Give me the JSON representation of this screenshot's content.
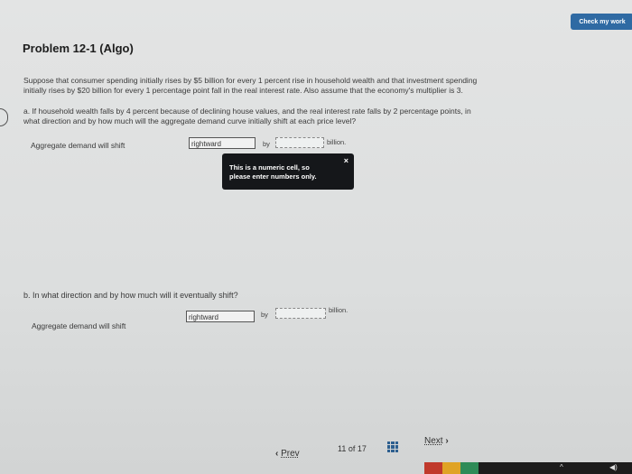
{
  "header": {
    "check_button": "Check my work"
  },
  "problem": {
    "title": "Problem 12-1 (Algo)",
    "intro_line1": "Suppose that consumer spending initially rises by $5 billion for every 1 percent rise in household wealth and that investment spending",
    "intro_line2": "initially rises by $20 billion for every 1 percentage point fall in the real interest rate. Also assume that the economy's multiplier is 3.",
    "part_a_line1": "a. If household wealth falls by 4 percent because of declining house values, and the real interest rate falls by 2 percentage points, in",
    "part_a_line2": "what direction and by how much will the aggregate demand curve initially shift at each price level?",
    "part_b": "b. In what direction and by how much will it eventually shift?"
  },
  "part_a_row": {
    "label": "Aggregate demand will shift",
    "direction_value": "rightward",
    "by_label": "by",
    "amount_value": "",
    "unit_label": "billion."
  },
  "tooltip": {
    "line1": "This is a numeric cell, so",
    "line2": "please enter numbers only.",
    "close_glyph": "×"
  },
  "part_b_row": {
    "label": "Aggregate demand will shift",
    "direction_value": "rightward",
    "by_label": "by",
    "amount_value": "",
    "unit_label": "billion."
  },
  "footer": {
    "prev_label": "Prev",
    "prev_glyph": "‹",
    "page_current": "11",
    "page_of": "of",
    "page_total": "17",
    "next_label": "Next",
    "next_glyph": "›"
  },
  "taskbar": {
    "tray_caret": "^",
    "tray_volume": "◀)"
  },
  "colors": {
    "accent": "#2f6aa3",
    "tooltip_bg": "#15171a",
    "page_bg": "#dcdede"
  }
}
